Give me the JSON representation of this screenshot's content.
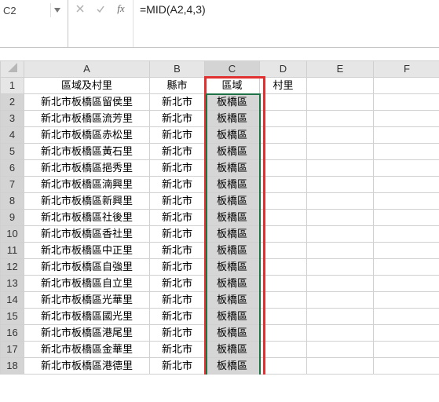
{
  "namebox": {
    "value": "C2"
  },
  "formula": {
    "value": "=MID(A2,4,3)"
  },
  "columns": [
    "A",
    "B",
    "C",
    "D",
    "E",
    "F"
  ],
  "header_row": {
    "A": "區域及村里",
    "B": "縣市",
    "C": "區域",
    "D": "村里",
    "E": "",
    "F": ""
  },
  "rows": [
    {
      "A": "新北市板橋區留侯里",
      "B": "新北市",
      "C": "板橋區"
    },
    {
      "A": "新北市板橋區流芳里",
      "B": "新北市",
      "C": "板橋區"
    },
    {
      "A": "新北市板橋區赤松里",
      "B": "新北市",
      "C": "板橋區"
    },
    {
      "A": "新北市板橋區黃石里",
      "B": "新北市",
      "C": "板橋區"
    },
    {
      "A": "新北市板橋區挹秀里",
      "B": "新北市",
      "C": "板橋區"
    },
    {
      "A": "新北市板橋區湳興里",
      "B": "新北市",
      "C": "板橋區"
    },
    {
      "A": "新北市板橋區新興里",
      "B": "新北市",
      "C": "板橋區"
    },
    {
      "A": "新北市板橋區社後里",
      "B": "新北市",
      "C": "板橋區"
    },
    {
      "A": "新北市板橋區香社里",
      "B": "新北市",
      "C": "板橋區"
    },
    {
      "A": "新北市板橋區中正里",
      "B": "新北市",
      "C": "板橋區"
    },
    {
      "A": "新北市板橋區自強里",
      "B": "新北市",
      "C": "板橋區"
    },
    {
      "A": "新北市板橋區自立里",
      "B": "新北市",
      "C": "板橋區"
    },
    {
      "A": "新北市板橋區光華里",
      "B": "新北市",
      "C": "板橋區"
    },
    {
      "A": "新北市板橋區國光里",
      "B": "新北市",
      "C": "板橋區"
    },
    {
      "A": "新北市板橋區港尾里",
      "B": "新北市",
      "C": "板橋區"
    },
    {
      "A": "新北市板橋區金華里",
      "B": "新北市",
      "C": "板橋區"
    },
    {
      "A": "新北市板橋區港德里",
      "B": "新北市",
      "C": "板橋區"
    }
  ]
}
